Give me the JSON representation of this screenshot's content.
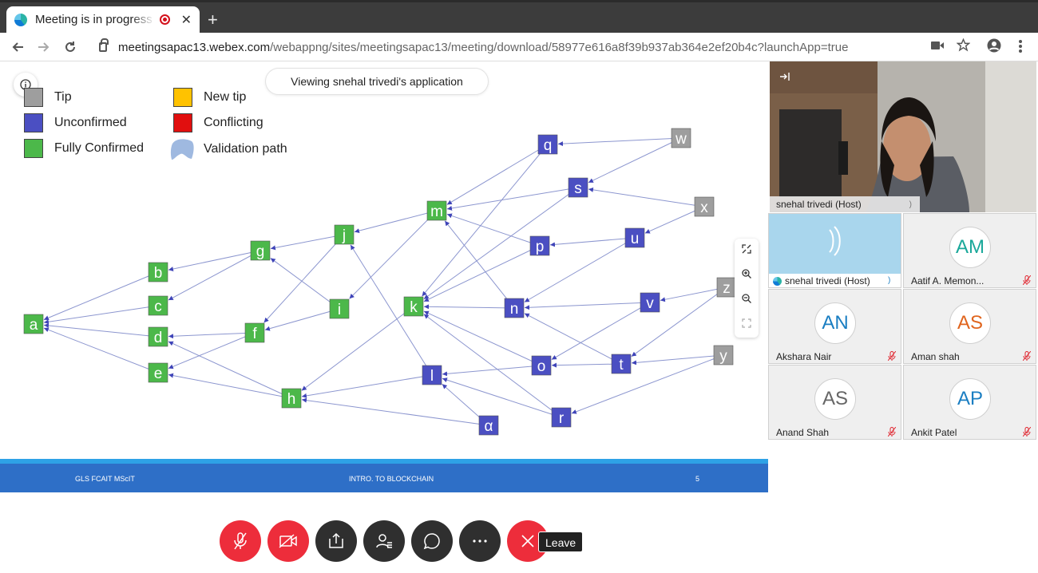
{
  "browser": {
    "tab_title": "Meeting is in progress",
    "close_glyph": "✕",
    "newtab_glyph": "+",
    "url_domain": "meetingsapac13.webex.com",
    "url_path": "/webappng/sites/meetingsapac13/meeting/download/58977e616a8f39b937ab364e2ef20b4c?launchApp=true",
    "icons": [
      "back-icon",
      "forward-icon",
      "reload-icon",
      "lock-icon",
      "camera-icon",
      "star-icon",
      "account-icon",
      "menu-icon"
    ]
  },
  "share_banner": "Viewing snehal trivedi's application",
  "legend": [
    {
      "label": "Tip",
      "color": "#9e9e9e"
    },
    {
      "label": "Unconfirmed",
      "color": "#4b4fc2"
    },
    {
      "label": "Fully Confirmed",
      "color": "#4cb84a"
    },
    {
      "label": "New tip",
      "color": "#ffc200"
    },
    {
      "label": "Conflicting",
      "color": "#e10f0f"
    },
    {
      "label": "Validation path",
      "color": "#9fb9e0"
    }
  ],
  "colors": {
    "tip": "#9e9e9e",
    "unconfirmed": "#4b4fc2",
    "confirmed": "#4cb84a",
    "edge": "#8c96cf",
    "leave": "#ed2d3b"
  },
  "graph": {
    "nodes": [
      {
        "id": "a",
        "type": "confirmed"
      },
      {
        "id": "b",
        "type": "confirmed"
      },
      {
        "id": "c",
        "type": "confirmed"
      },
      {
        "id": "d",
        "type": "confirmed"
      },
      {
        "id": "e",
        "type": "confirmed"
      },
      {
        "id": "g",
        "type": "confirmed"
      },
      {
        "id": "f",
        "type": "confirmed"
      },
      {
        "id": "h",
        "type": "confirmed"
      },
      {
        "id": "j",
        "type": "confirmed"
      },
      {
        "id": "i",
        "type": "confirmed"
      },
      {
        "id": "m",
        "type": "confirmed"
      },
      {
        "id": "k",
        "type": "confirmed"
      },
      {
        "id": "l",
        "type": "unconfirmed"
      },
      {
        "id": "α",
        "type": "unconfirmed"
      },
      {
        "id": "q",
        "type": "unconfirmed"
      },
      {
        "id": "s",
        "type": "unconfirmed"
      },
      {
        "id": "p",
        "type": "unconfirmed"
      },
      {
        "id": "n",
        "type": "unconfirmed"
      },
      {
        "id": "o",
        "type": "unconfirmed"
      },
      {
        "id": "r",
        "type": "unconfirmed"
      },
      {
        "id": "u",
        "type": "unconfirmed"
      },
      {
        "id": "v",
        "type": "unconfirmed"
      },
      {
        "id": "t",
        "type": "unconfirmed"
      },
      {
        "id": "w",
        "type": "tip"
      },
      {
        "id": "x",
        "type": "tip"
      },
      {
        "id": "z",
        "type": "tip"
      },
      {
        "id": "y",
        "type": "tip"
      }
    ],
    "edges": [
      [
        "b",
        "a"
      ],
      [
        "c",
        "a"
      ],
      [
        "d",
        "a"
      ],
      [
        "e",
        "a"
      ],
      [
        "g",
        "b"
      ],
      [
        "g",
        "c"
      ],
      [
        "f",
        "d"
      ],
      [
        "f",
        "e"
      ],
      [
        "h",
        "d"
      ],
      [
        "h",
        "e"
      ],
      [
        "j",
        "g"
      ],
      [
        "i",
        "g"
      ],
      [
        "j",
        "f"
      ],
      [
        "i",
        "f"
      ],
      [
        "m",
        "j"
      ],
      [
        "m",
        "i"
      ],
      [
        "k",
        "h"
      ],
      [
        "l",
        "j"
      ],
      [
        "l",
        "h"
      ],
      [
        "α",
        "h"
      ],
      [
        "q",
        "m"
      ],
      [
        "s",
        "m"
      ],
      [
        "p",
        "m"
      ],
      [
        "n",
        "m"
      ],
      [
        "q",
        "k"
      ],
      [
        "s",
        "k"
      ],
      [
        "p",
        "k"
      ],
      [
        "n",
        "k"
      ],
      [
        "o",
        "k"
      ],
      [
        "r",
        "k"
      ],
      [
        "o",
        "l"
      ],
      [
        "r",
        "l"
      ],
      [
        "α",
        "l"
      ],
      [
        "w",
        "q"
      ],
      [
        "w",
        "s"
      ],
      [
        "x",
        "s"
      ],
      [
        "x",
        "u"
      ],
      [
        "u",
        "p"
      ],
      [
        "u",
        "n"
      ],
      [
        "v",
        "n"
      ],
      [
        "v",
        "o"
      ],
      [
        "t",
        "n"
      ],
      [
        "t",
        "o"
      ],
      [
        "z",
        "v"
      ],
      [
        "z",
        "t"
      ],
      [
        "y",
        "t"
      ],
      [
        "y",
        "r"
      ]
    ]
  },
  "zoom_icons": [
    "fullscreen-icon",
    "zoom-in-icon",
    "zoom-out-icon",
    "fit-icon"
  ],
  "footer": {
    "left": "GLS FCAIT MScIT",
    "center": "INTRO. TO BLOCKCHAIN",
    "right": "5"
  },
  "host": {
    "name": "snehal trivedi",
    "role": "(Host)"
  },
  "participants": [
    {
      "initials": "",
      "name": "snehal trivedi",
      "role": "(Host)",
      "active": true,
      "muted": false
    },
    {
      "initials": "AM",
      "name": "Aatif A. Memon...",
      "color": "#1aa89a",
      "muted": true
    },
    {
      "initials": "AN",
      "name": "Akshara Nair",
      "color": "#1a7ec2",
      "muted": true
    },
    {
      "initials": "AS",
      "name": "Aman shah",
      "color": "#e0651e",
      "muted": true
    },
    {
      "initials": "AS",
      "name": "Anand Shah",
      "color": "#666666",
      "muted": true
    },
    {
      "initials": "AP",
      "name": "Ankit Patel",
      "color": "#1a7ec2",
      "muted": true
    }
  ],
  "controls": {
    "leave_tooltip": "Leave"
  }
}
